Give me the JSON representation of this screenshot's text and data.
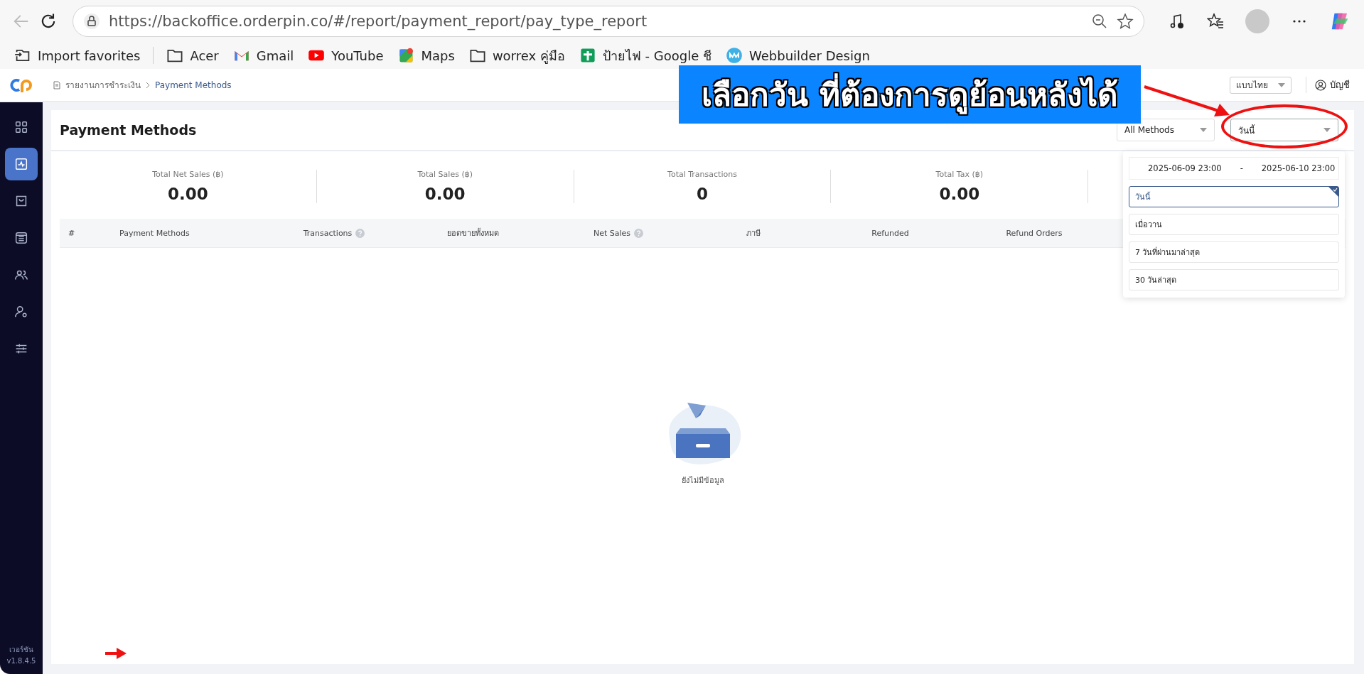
{
  "browser": {
    "url": "https://backoffice.orderpin.co/#/report/payment_report/pay_type_report",
    "bookmarks": [
      {
        "label": "Import favorites",
        "kind": "import"
      },
      {
        "label": "Acer",
        "kind": "folder"
      },
      {
        "label": "Gmail",
        "kind": "gmail"
      },
      {
        "label": "YouTube",
        "kind": "youtube"
      },
      {
        "label": "Maps",
        "kind": "maps"
      },
      {
        "label": "worrex คู่มือ",
        "kind": "folder"
      },
      {
        "label": "ป้ายไฟ - Google ชี",
        "kind": "sheets"
      },
      {
        "label": "Webbuilder Design",
        "kind": "web"
      }
    ]
  },
  "annotation": {
    "banner": "เลือกวัน ที่ต้องการดูย้อนหลังได้"
  },
  "sidebar": {
    "items": [
      {
        "kind": "dashboard",
        "selected": false
      },
      {
        "kind": "report",
        "selected": true
      },
      {
        "kind": "bag",
        "selected": false
      },
      {
        "kind": "archive",
        "selected": false
      },
      {
        "kind": "users",
        "selected": false
      },
      {
        "kind": "user-settings",
        "selected": false
      },
      {
        "kind": "sliders",
        "selected": false
      }
    ],
    "version_label": "เวอร์ชัน",
    "version": "v1.8.4.5"
  },
  "header": {
    "breadcrumb": [
      "รายงานการชำระเงิน",
      "Payment Methods"
    ],
    "language": "แบบไทย",
    "account": "บัญชี"
  },
  "page": {
    "title": "Payment Methods",
    "filters": {
      "method": "All Methods",
      "date_preset": "วันนี้"
    },
    "stats": [
      {
        "label": "Total Net Sales (฿)",
        "value": "0.00"
      },
      {
        "label": "Total Sales (฿)",
        "value": "0.00"
      },
      {
        "label": "Total Transactions",
        "value": "0"
      },
      {
        "label": "Total Tax (฿)",
        "value": "0.00"
      }
    ],
    "table": {
      "columns": [
        {
          "label": "#",
          "help": false
        },
        {
          "label": "Payment Methods",
          "help": false
        },
        {
          "label": "Transactions",
          "help": true
        },
        {
          "label": "ยอดขายทั้งหมด",
          "help": false
        },
        {
          "label": "Net Sales",
          "help": true
        },
        {
          "label": "ภาษี",
          "help": false
        },
        {
          "label": "Refunded",
          "help": false
        },
        {
          "label": "Refund Orders",
          "help": false
        }
      ],
      "empty": "ยังไม่มีข้อมูล"
    },
    "date_dropdown": {
      "start": "2025-06-09 23:00",
      "separator": "-",
      "end": "2025-06-10 23:00",
      "options": [
        {
          "label": "วันนี้",
          "selected": true
        },
        {
          "label": "เมื่อวาน",
          "selected": false
        },
        {
          "label": "7 วันที่ผ่านมาล่าสุด",
          "selected": false
        },
        {
          "label": "30 วันล่าสุด",
          "selected": false
        }
      ]
    }
  }
}
